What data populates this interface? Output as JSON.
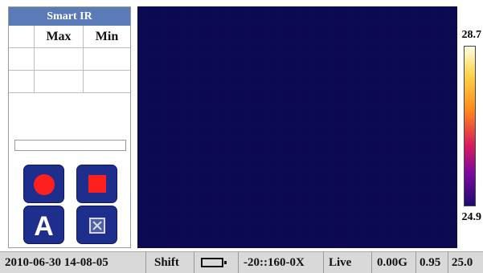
{
  "panel": {
    "title": "Smart IR",
    "headers": [
      "",
      "Max",
      "Min"
    ],
    "rows": [
      [
        "",
        "",
        ""
      ],
      [
        "",
        "",
        ""
      ]
    ],
    "progress": 0
  },
  "buttons": {
    "record_icon": "record-dot-icon",
    "stop_icon": "stop-square-icon",
    "auto_label": "A",
    "snapshot_icon": "snapshot-frame-icon"
  },
  "thermal": {
    "scale_max": "28.7",
    "scale_min": "24.9",
    "colormap": [
      "#ffffe0",
      "#ffd34a",
      "#ff8a1a",
      "#d81b5c",
      "#7a0aa0",
      "#1e0a70"
    ]
  },
  "status": {
    "datetime": "2010-06-30 14-08-05",
    "shift": "Shift",
    "battery_icon": "battery-icon",
    "range": "-20::160-0X",
    "mode": "Live",
    "gain": "0.00G",
    "emissivity": "0.95",
    "temp": "25.0"
  },
  "colors": {
    "panel_title_bg": "#5a7ab8",
    "thermal_bg": "#0c0a52",
    "button_bg": "#1e2e8c",
    "accent_red": "#ff1f1f"
  }
}
